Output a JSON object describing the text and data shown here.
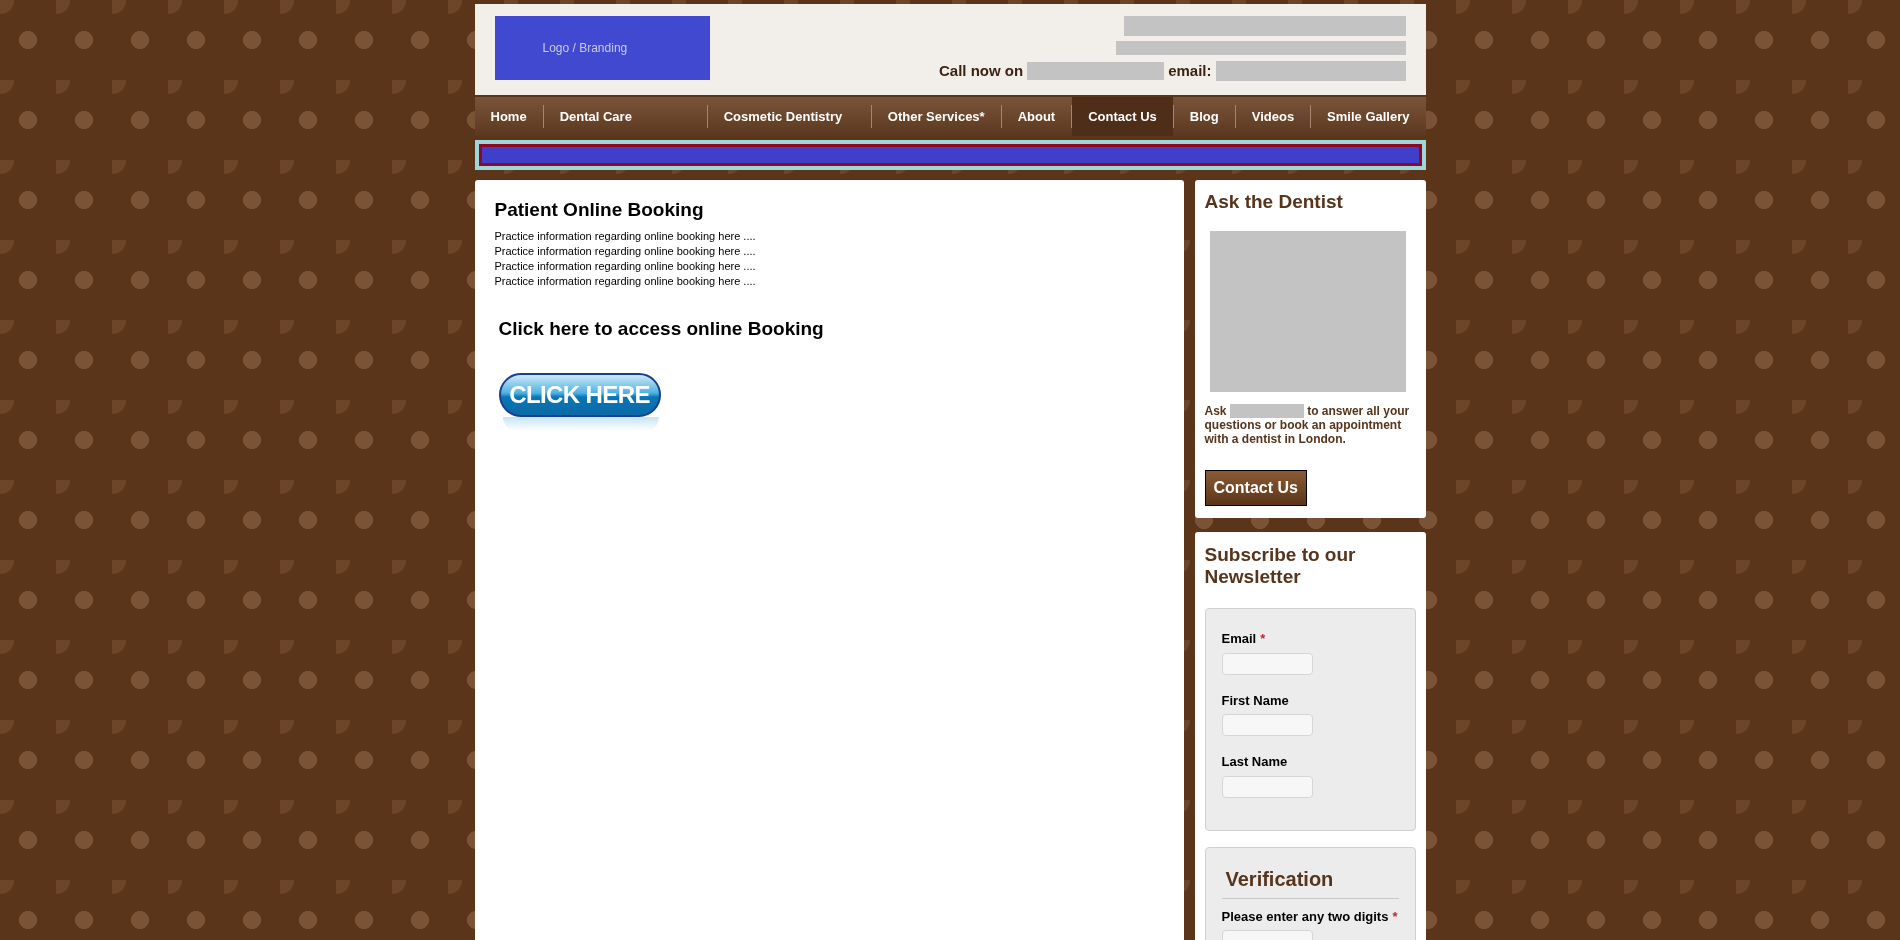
{
  "header": {
    "logo": "Logo / Branding",
    "call_label": "Call now on",
    "email_label": "email:"
  },
  "nav": [
    {
      "label": "Home",
      "selected": false
    },
    {
      "label": "Dental Care",
      "selected": false
    },
    {
      "label": "Cosmetic Dentistry",
      "selected": false
    },
    {
      "label": "Other Services*",
      "selected": false
    },
    {
      "label": "About",
      "selected": false
    },
    {
      "label": "Contact Us",
      "selected": true
    },
    {
      "label": "Blog",
      "selected": false
    },
    {
      "label": "Videos",
      "selected": false
    },
    {
      "label": "Smile Gallery",
      "selected": false
    }
  ],
  "main": {
    "title": "Patient Online Booking",
    "lines": [
      "Practice information regarding online booking here ....",
      "Practice information regarding online booking here ....",
      "Practice information regarding online booking here ....",
      "Practice information regarding online booking here ...."
    ],
    "cta_heading": "Click here to access online Booking",
    "cta_button": "CLICK HERE"
  },
  "ask": {
    "title": "Ask the Dentist",
    "text_before": "Ask",
    "text_after": "to answer all your questions or book an appointment with a dentist in London.",
    "button": "Contact Us"
  },
  "newsletter": {
    "title": "Subscribe to our Newsletter",
    "fields": [
      {
        "label": "Email",
        "required_mark": "*"
      },
      {
        "label": "First Name"
      },
      {
        "label": "Last Name"
      }
    ],
    "verification": {
      "title": "Verification",
      "fields": [
        {
          "label": "Please enter any two digits",
          "required_mark": "*"
        }
      ]
    }
  }
}
